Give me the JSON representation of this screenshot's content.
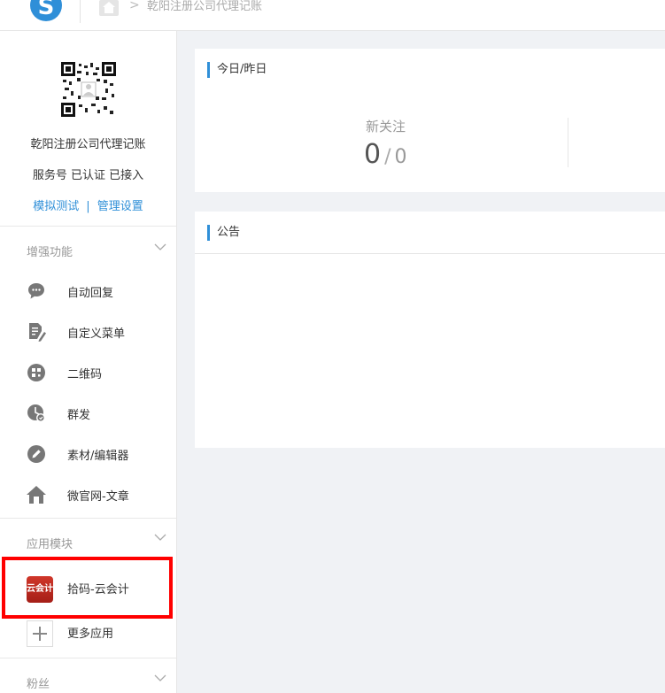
{
  "header": {
    "breadcrumb": "乾阳注册公司代理记账",
    "breadcrumb_separator": ">"
  },
  "account": {
    "name": "乾阳注册公司代理记账",
    "status": "服务号 已认证 已接入",
    "link_simulate": "模拟测试",
    "link_separator": "|",
    "link_settings": "管理设置"
  },
  "sidebar": {
    "enhance_title": "增强功能",
    "enhance_items": [
      {
        "label": "自动回复",
        "icon": "chat-bubble-icon"
      },
      {
        "label": "自定义菜单",
        "icon": "document-edit-icon"
      },
      {
        "label": "二维码",
        "icon": "qrcode-icon"
      },
      {
        "label": "群发",
        "icon": "broadcast-icon"
      },
      {
        "label": "素材/编辑器",
        "icon": "pencil-icon"
      },
      {
        "label": "微官网-文章",
        "icon": "home-icon"
      }
    ],
    "apps_title": "应用模块",
    "apps_items": [
      {
        "label": "拾码-云会计",
        "icon_text": "云会计"
      },
      {
        "label": "更多应用",
        "icon": "plus-icon"
      }
    ],
    "fans_title": "粉丝"
  },
  "main": {
    "today_panel_title": "今日/昨日",
    "stat_label": "新关注",
    "stat_today": "0",
    "stat_separator": "/",
    "stat_yesterday": "0",
    "notice_panel_title": "公告"
  },
  "colors": {
    "accent": "#2f8fd8",
    "highlight": "#ff0000",
    "app_icon": "#c42d22"
  }
}
